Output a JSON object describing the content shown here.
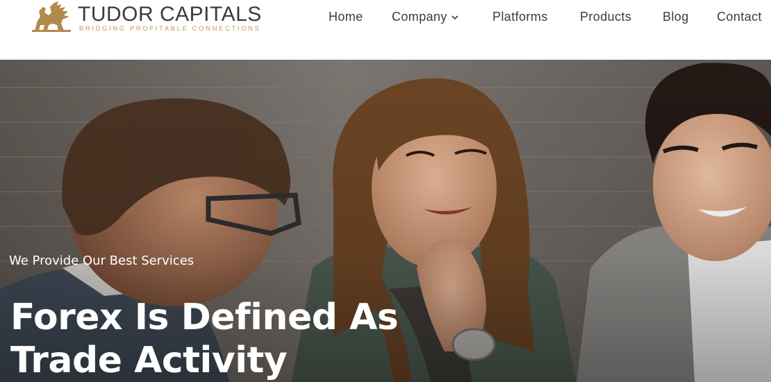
{
  "brand": {
    "name": "TUDOR CAPITALS",
    "tagline": "BRIDGING PROFITABLE CONNECTIONS",
    "logo_icon": "griffin-icon",
    "gold_color": "#b28a4c"
  },
  "nav": {
    "items": [
      {
        "label": "Home"
      },
      {
        "label": "Company",
        "icon": "chevron-down-icon"
      },
      {
        "label": "Platforms"
      },
      {
        "label": "Products"
      },
      {
        "label": "Blog"
      },
      {
        "label": "Contact"
      }
    ]
  },
  "hero": {
    "eyebrow": "We Provide Our Best Services",
    "title_line1": "Forex Is Defined As",
    "title_line2": "Trade Activity",
    "image": "three-people-in-business-meeting"
  }
}
